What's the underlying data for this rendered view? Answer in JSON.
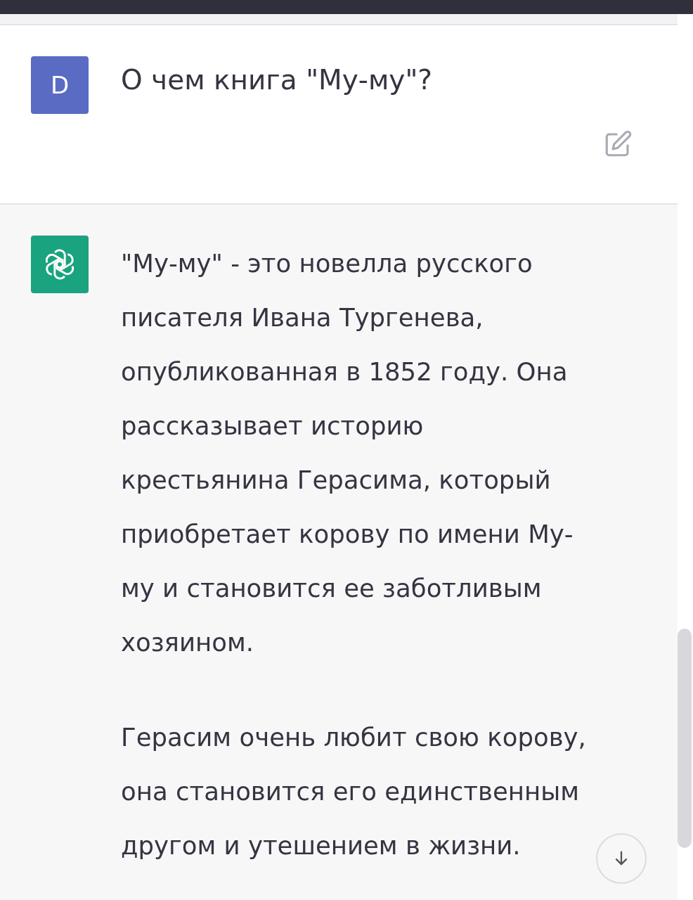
{
  "messages": [
    {
      "kind": "user",
      "avatar": "D",
      "text": "О чем книга \"Му-му\"?",
      "editable": true
    },
    {
      "kind": "assistant",
      "paragraphs": [
        "\"Му-му\" - это новелла русского писателя Ивана Тургенева, опубликованная в 1852 году. Она рассказывает историю крестьянина Герасима, который приобретает корову по имени Му-му и становится ее заботливым хозяином.",
        "Герасим очень любит свою корову, она становится его единственным другом и утешением в жизни."
      ]
    }
  ]
}
